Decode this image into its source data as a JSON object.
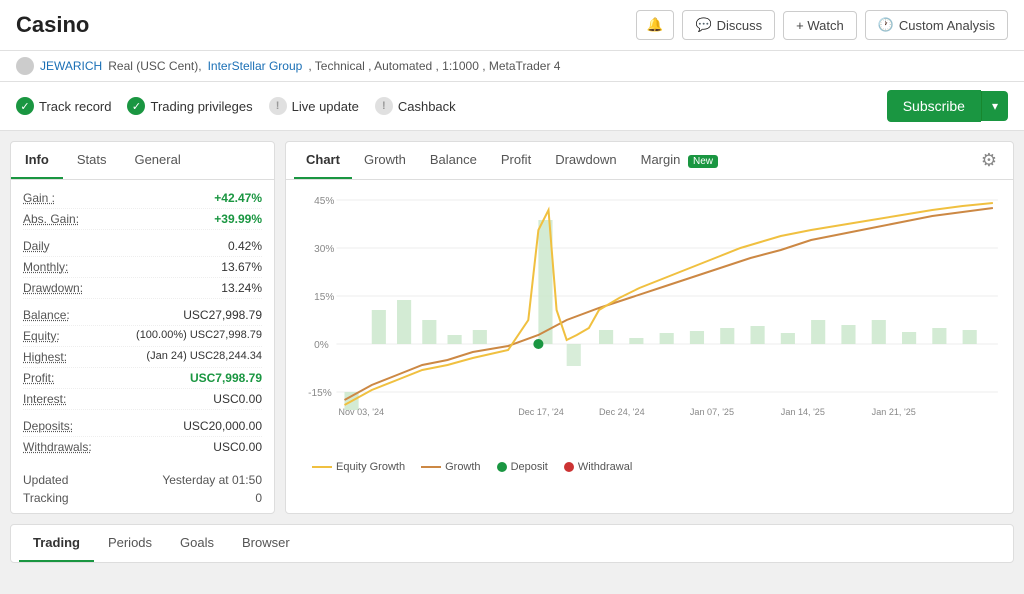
{
  "header": {
    "title": "Casino",
    "actions": {
      "bell_label": "🔔",
      "discuss_label": "Discuss",
      "watch_label": "+ Watch",
      "custom_analysis_label": "Custom Analysis"
    }
  },
  "sub_header": {
    "user": "JEWARICH",
    "account_type": "Real (USC Cent),",
    "group_link": "InterStellar Group",
    "details": ", Technical , Automated , 1:1000 , MetaTrader 4"
  },
  "badges": [
    {
      "id": "track-record",
      "label": "Track record",
      "type": "green"
    },
    {
      "id": "trading-privileges",
      "label": "Trading privileges",
      "type": "green"
    },
    {
      "id": "live-update",
      "label": "Live update",
      "type": "warn"
    },
    {
      "id": "cashback",
      "label": "Cashback",
      "type": "warn"
    }
  ],
  "subscribe": {
    "label": "Subscribe"
  },
  "left_panel": {
    "tabs": [
      "Info",
      "Stats",
      "General"
    ],
    "active_tab": "Info",
    "info": {
      "gain_label": "Gain :",
      "gain_value": "+42.47%",
      "abs_gain_label": "Abs. Gain:",
      "abs_gain_value": "+39.99%",
      "daily_label": "Daily",
      "daily_value": "0.42%",
      "monthly_label": "Monthly:",
      "monthly_value": "13.67%",
      "drawdown_label": "Drawdown:",
      "drawdown_value": "13.24%",
      "balance_label": "Balance:",
      "balance_value": "USC27,998.79",
      "equity_label": "Equity:",
      "equity_value": "(100.00%) USC27,998.79",
      "highest_label": "Highest:",
      "highest_value": "(Jan 24) USC28,244.34",
      "profit_label": "Profit:",
      "profit_value": "USC7,998.79",
      "interest_label": "Interest:",
      "interest_value": "USC0.00",
      "deposits_label": "Deposits:",
      "deposits_value": "USC20,000.00",
      "withdrawals_label": "Withdrawals:",
      "withdrawals_value": "USC0.00",
      "updated_label": "Updated",
      "updated_value": "Yesterday at 01:50",
      "tracking_label": "Tracking",
      "tracking_value": "0"
    }
  },
  "right_panel": {
    "tabs": [
      "Chart",
      "Growth",
      "Balance",
      "Profit",
      "Drawdown",
      "Margin"
    ],
    "active_tab": "Chart",
    "new_badge_tab": "Margin",
    "x_labels": [
      "Nov 03, '24",
      "Dec 17, '24",
      "Dec 24, '24",
      "Jan 07, '25",
      "Jan 14, '25",
      "Jan 21, '25"
    ],
    "y_labels": [
      "45%",
      "30%",
      "15%",
      "0%",
      "-15%"
    ],
    "legend": [
      {
        "type": "line-yellow",
        "label": "Equity Growth"
      },
      {
        "type": "line-orange",
        "label": "Growth"
      },
      {
        "type": "dot-green",
        "label": "Deposit"
      },
      {
        "type": "dot-red",
        "label": "Withdrawal"
      }
    ]
  },
  "bottom_tabs": {
    "tabs": [
      "Trading",
      "Periods",
      "Goals",
      "Browser"
    ],
    "active_tab": "Trading"
  }
}
